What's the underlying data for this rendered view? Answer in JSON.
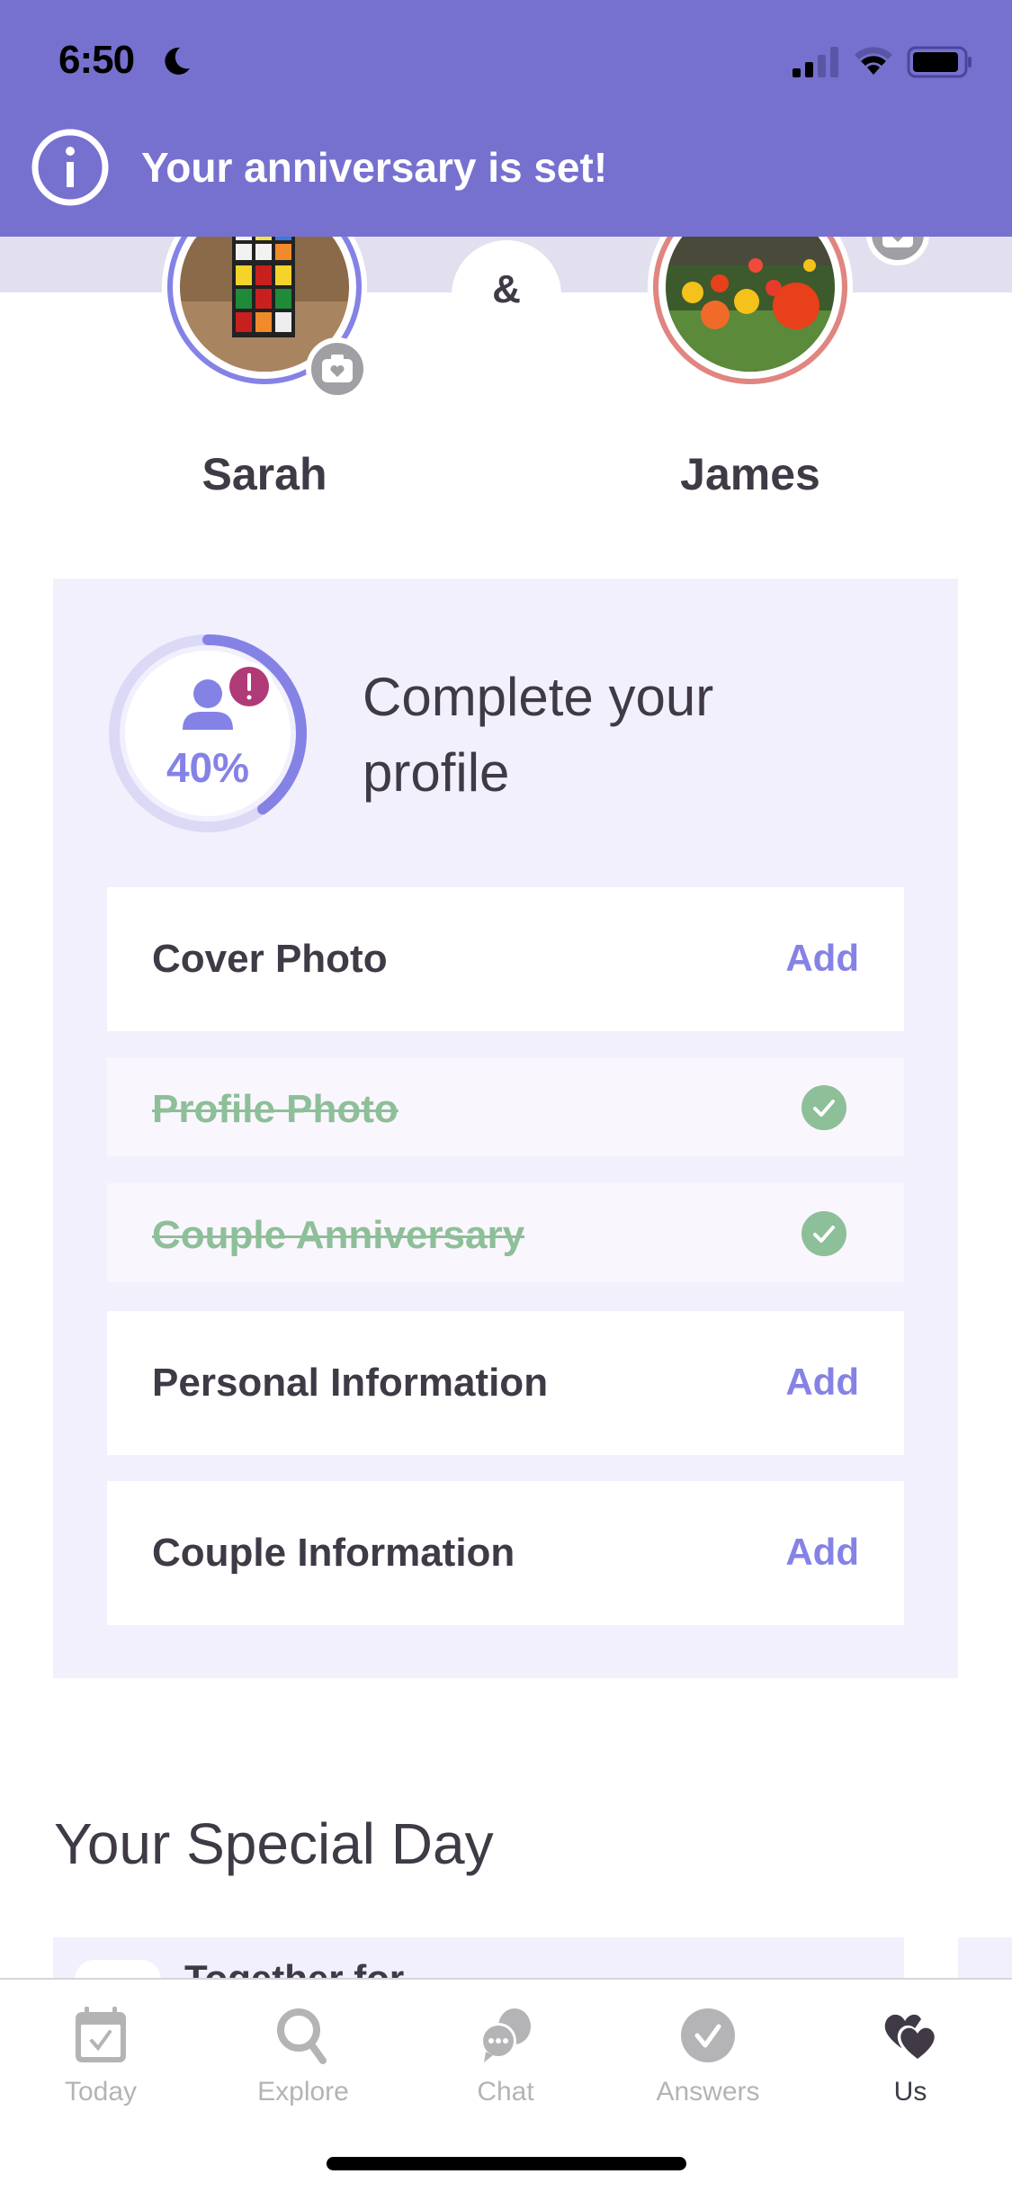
{
  "status_bar": {
    "time": "6:50"
  },
  "banner": {
    "message": "Your anniversary is set!",
    "color": "#7671cf"
  },
  "couple": {
    "partner_1": {
      "name": "Sarah",
      "ring_color": "#8582e6",
      "photo": "rubiks-cube-photo"
    },
    "separator": "&",
    "partner_2": {
      "name": "James",
      "ring_color": "#e08580",
      "photo": "tulip-garden-photo"
    }
  },
  "profile_completion": {
    "title": "Complete your profile",
    "progress_percent": 40,
    "progress_label": "40%",
    "items": [
      {
        "label": "Cover Photo",
        "status": "todo",
        "action": "Add"
      },
      {
        "label": "Profile Photo",
        "status": "done"
      },
      {
        "label": "Couple Anniversary",
        "status": "done"
      },
      {
        "label": "Personal Information",
        "status": "todo",
        "action": "Add"
      },
      {
        "label": "Couple Information",
        "status": "todo",
        "action": "Add"
      }
    ]
  },
  "special_day": {
    "title": "Your Special Day",
    "card_text": "Together for"
  },
  "tab_bar": {
    "tabs": [
      {
        "label": "Today",
        "icon": "calendar-check-icon",
        "active": false
      },
      {
        "label": "Explore",
        "icon": "search-icon",
        "active": false
      },
      {
        "label": "Chat",
        "icon": "chat-bubbles-icon",
        "active": false
      },
      {
        "label": "Answers",
        "icon": "check-circle-icon",
        "active": false
      },
      {
        "label": "Us",
        "icon": "hearts-icon",
        "active": true
      }
    ]
  },
  "colors": {
    "accent": "#8582e6",
    "done": "#8dbf98",
    "alert": "#b03a78",
    "text": "#3f3a45"
  }
}
